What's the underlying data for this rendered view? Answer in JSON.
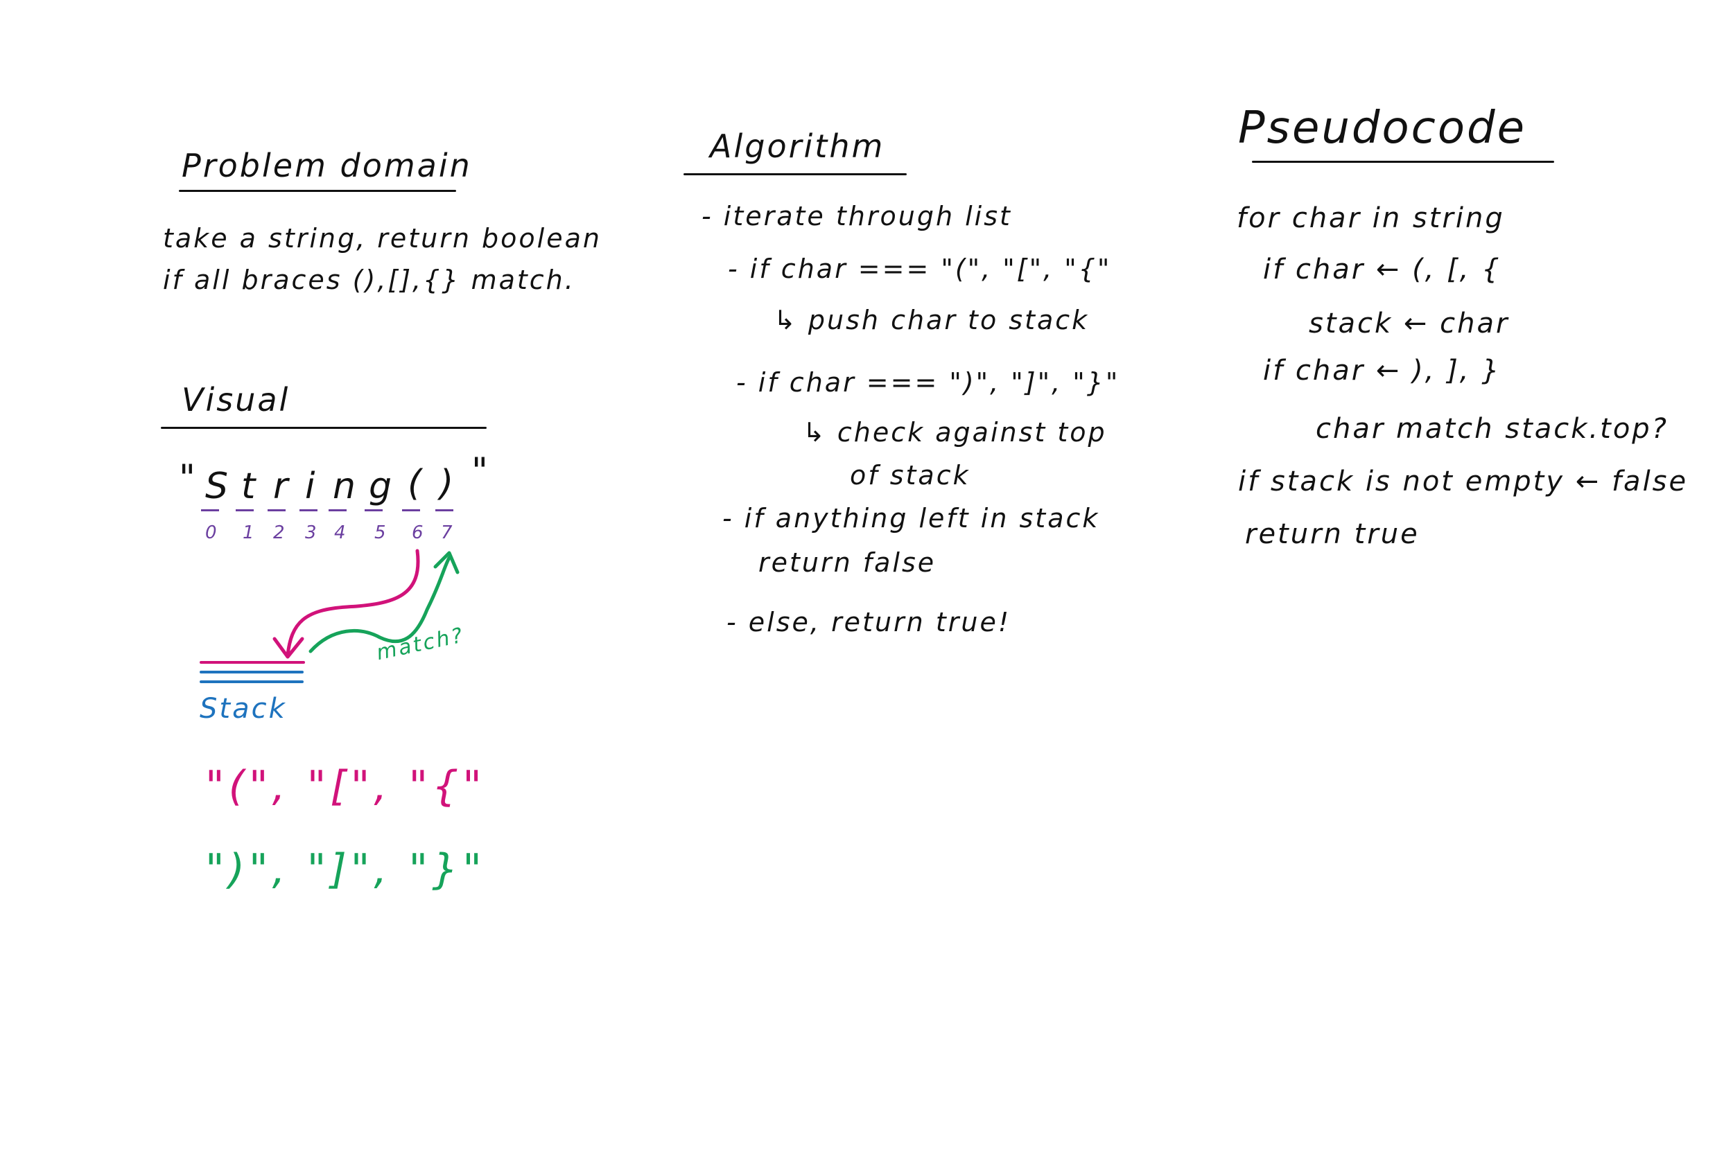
{
  "colors": {
    "ink": "#111111",
    "purple": "#6b3fa0",
    "magenta": "#d1127a",
    "green": "#16a35a",
    "blue": "#1e73be"
  },
  "problem_domain": {
    "heading": "Problem domain",
    "lines": [
      "take a string, return boolean",
      "if all braces (),[],{} match."
    ]
  },
  "visual": {
    "heading": "Visual",
    "string_open_quote": "\"",
    "string_close_quote": "\"",
    "string_chars": [
      "S",
      "t",
      "r",
      "i",
      "n",
      "g",
      "(",
      ")"
    ],
    "indices": [
      "0",
      "1",
      "2",
      "3",
      "4",
      "5",
      "6",
      "7"
    ],
    "match_label": "match?",
    "stack_label": "Stack",
    "open_braces": "\"(\", \"[\", \"{\"",
    "close_braces": "\")\", \"]\", \"}\""
  },
  "algorithm": {
    "heading": "Algorithm",
    "lines": [
      "- iterate through list",
      "- if char === \"(\", \"[\", \"{\"",
      "↳ push char to stack",
      "- if char === \")\", \"]\", \"}\"",
      "↳ check against top",
      "of stack",
      "- if anything left in stack",
      "return false",
      "- else, return true!"
    ]
  },
  "pseudocode": {
    "heading": "Pseudocode",
    "lines": [
      "for char in string",
      "if char ← (, [, {",
      "stack ← char",
      "if char ← ), ], }",
      "char match stack.top?",
      "if stack is not empty ← false",
      "return true"
    ]
  }
}
